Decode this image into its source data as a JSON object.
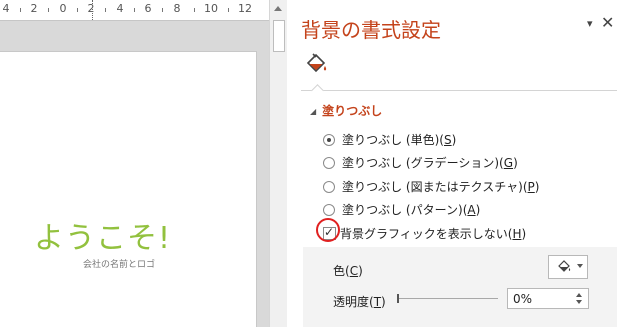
{
  "ruler": {
    "labels": [
      "4",
      "2",
      "0",
      "2",
      "4",
      "6",
      "8",
      "10",
      "12"
    ]
  },
  "slide": {
    "title": "ようこそ!",
    "subtitle": "会社の名前とロゴ"
  },
  "pane": {
    "title": "背景の書式設定",
    "menu_glyph": "▾",
    "close_glyph": "✕",
    "fill_tab_icon": "paint-bucket-icon",
    "section": {
      "label": "塗りつぶし",
      "expanded_glyph": "◢"
    },
    "fill_options": [
      {
        "label": "塗りつぶし (単色)(",
        "key": "S",
        "selected": true
      },
      {
        "label": "塗りつぶし (グラデーション)(",
        "key": "G",
        "selected": false
      },
      {
        "label": "塗りつぶし (図またはテクスチャ)(",
        "key": "P",
        "selected": false
      },
      {
        "label": "塗りつぶし (パターン)(",
        "key": "A",
        "selected": false
      }
    ],
    "hide_background_graphics": {
      "label": "背景グラフィックを表示しない(",
      "key": "H",
      "checked": true
    },
    "color": {
      "label": "色(",
      "key": "C",
      "icon": "paint-bucket-icon"
    },
    "transparency": {
      "label": "透明度(",
      "key": "T",
      "value": "0%",
      "level": 0
    },
    "colors": {
      "accent": "#c4431b",
      "title_green": "#92c13e",
      "highlight_circle": "#e02020"
    }
  }
}
